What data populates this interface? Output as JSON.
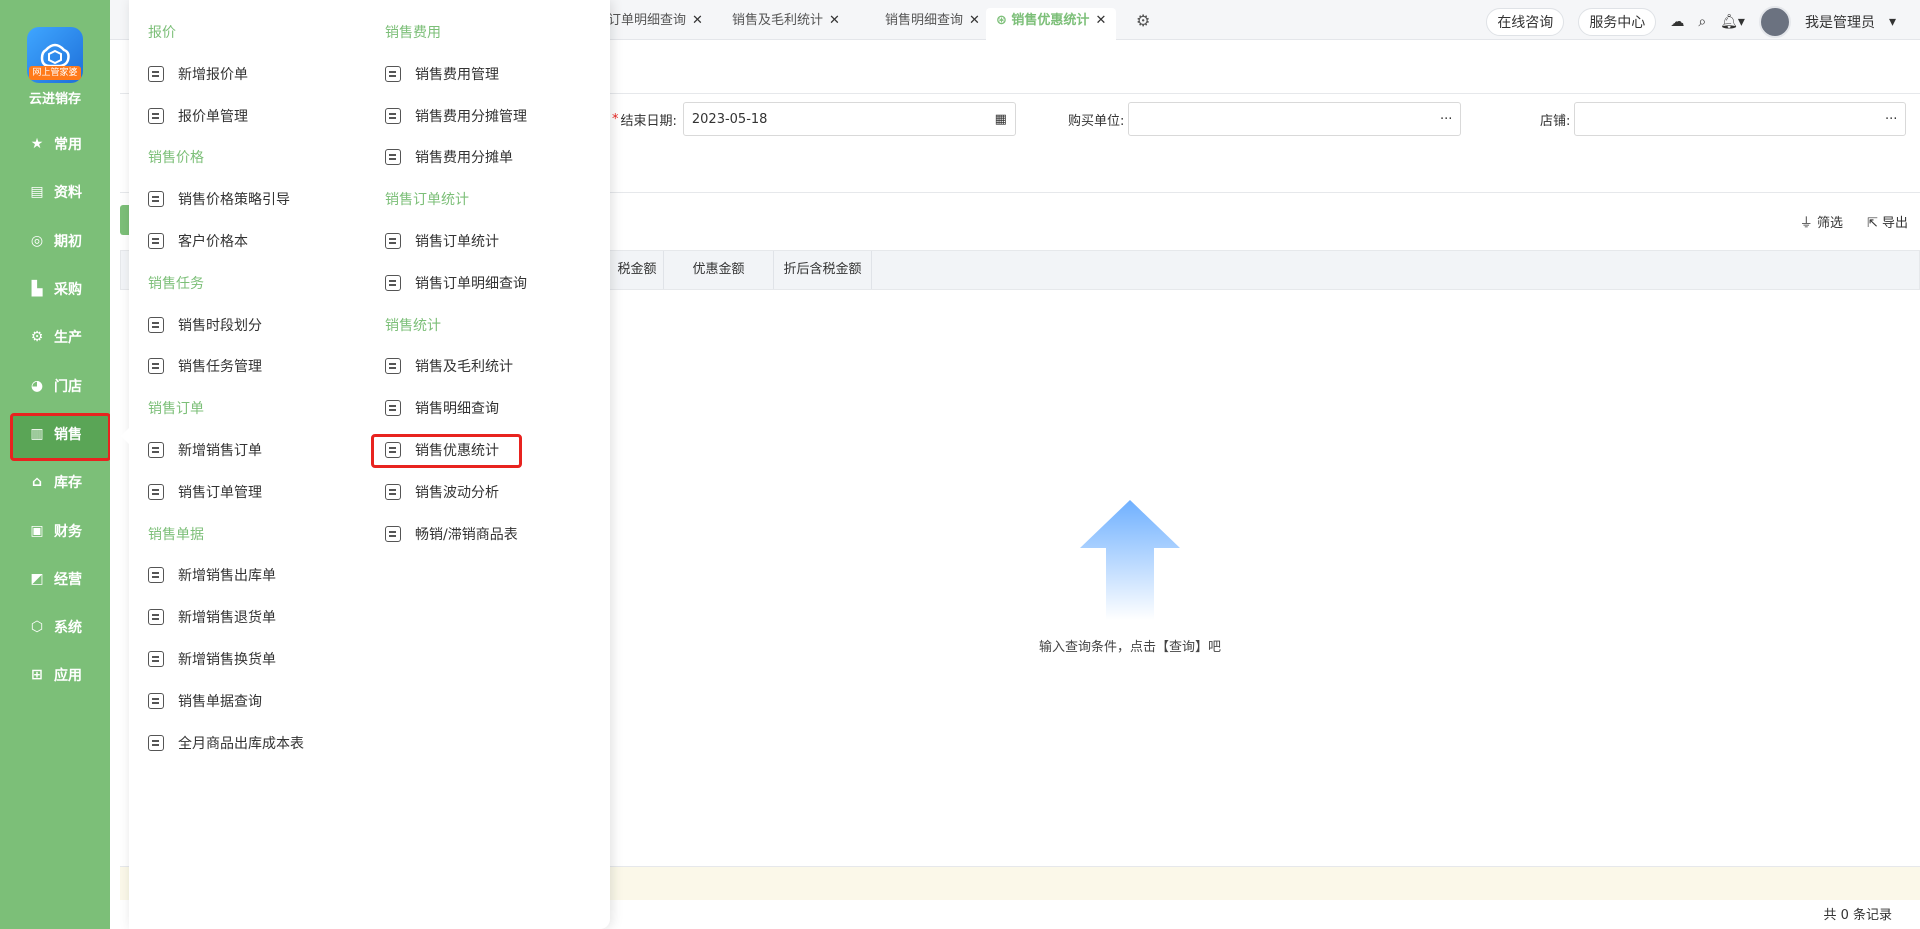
{
  "app": {
    "name": "云进销存",
    "badge": "网上管家婆"
  },
  "sidebar": {
    "items": [
      {
        "label": "常用",
        "icon": "star-icon"
      },
      {
        "label": "资料",
        "icon": "document-icon"
      },
      {
        "label": "期初",
        "icon": "target-icon"
      },
      {
        "label": "采购",
        "icon": "cart-icon"
      },
      {
        "label": "生产",
        "icon": "factory-icon"
      },
      {
        "label": "门店",
        "icon": "pie-icon"
      },
      {
        "label": "销售",
        "icon": "chart-icon"
      },
      {
        "label": "库存",
        "icon": "home-icon"
      },
      {
        "label": "财务",
        "icon": "wallet-icon"
      },
      {
        "label": "经营",
        "icon": "trend-icon"
      },
      {
        "label": "系统",
        "icon": "gear-icon"
      },
      {
        "label": "应用",
        "icon": "plus-icon"
      }
    ],
    "active": "销售"
  },
  "tabs": [
    {
      "label": "订单明细查询",
      "active": false
    },
    {
      "label": "销售及毛利统计",
      "active": false
    },
    {
      "label": "销售明细查询",
      "active": false
    },
    {
      "label": "销售优惠统计",
      "active": true
    }
  ],
  "topbar": {
    "consult": "在线咨询",
    "service": "服务中心",
    "user": "我是管理员"
  },
  "filters": {
    "end_date_label": "结束日期:",
    "end_date_value": "2023-05-18",
    "buyer_label": "购买单位:",
    "shop_label": "店铺:"
  },
  "toolbar": {
    "filter": "筛选",
    "export": "导出"
  },
  "table": {
    "columns": [
      "税金额",
      "优惠金额",
      "折后含税金额"
    ],
    "empty_hint": "输入查询条件，点击【查询】吧",
    "total": "共 0 条记录"
  },
  "menu": {
    "left": [
      {
        "type": "header",
        "label": "报价"
      },
      {
        "type": "item",
        "label": "新增报价单"
      },
      {
        "type": "item",
        "label": "报价单管理"
      },
      {
        "type": "header",
        "label": "销售价格"
      },
      {
        "type": "item",
        "label": "销售价格策略引导"
      },
      {
        "type": "item",
        "label": "客户价格本"
      },
      {
        "type": "header",
        "label": "销售任务"
      },
      {
        "type": "item",
        "label": "销售时段划分"
      },
      {
        "type": "item",
        "label": "销售任务管理"
      },
      {
        "type": "header",
        "label": "销售订单"
      },
      {
        "type": "item",
        "label": "新增销售订单"
      },
      {
        "type": "item",
        "label": "销售订单管理"
      },
      {
        "type": "header",
        "label": "销售单据"
      },
      {
        "type": "item",
        "label": "新增销售出库单"
      },
      {
        "type": "item",
        "label": "新增销售退货单"
      },
      {
        "type": "item",
        "label": "新增销售换货单"
      },
      {
        "type": "item",
        "label": "销售单据查询"
      },
      {
        "type": "item",
        "label": "全月商品出库成本表"
      }
    ],
    "right": [
      {
        "type": "header",
        "label": "销售费用"
      },
      {
        "type": "item",
        "label": "销售费用管理"
      },
      {
        "type": "item",
        "label": "销售费用分摊管理"
      },
      {
        "type": "item",
        "label": "销售费用分摊单"
      },
      {
        "type": "header",
        "label": "销售订单统计"
      },
      {
        "type": "item",
        "label": "销售订单统计"
      },
      {
        "type": "item",
        "label": "销售订单明细查询"
      },
      {
        "type": "header",
        "label": "销售统计"
      },
      {
        "type": "item",
        "label": "销售及毛利统计"
      },
      {
        "type": "item",
        "label": "销售明细查询"
      },
      {
        "type": "item",
        "label": "销售优惠统计"
      },
      {
        "type": "item",
        "label": "销售波动分析"
      },
      {
        "type": "item",
        "label": "畅销/滞销商品表"
      }
    ]
  },
  "colors": {
    "brand_green": "#7cbf78",
    "highlight_red": "#e8231f"
  }
}
